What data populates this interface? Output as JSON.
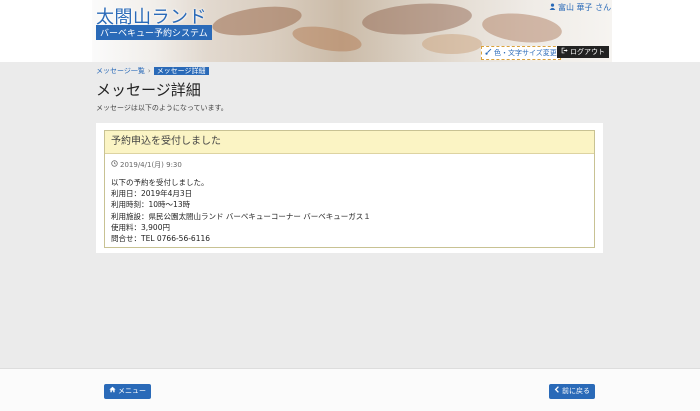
{
  "header": {
    "site_title": "太閤山ランド",
    "site_subtitle": "バーベキュー予約システム",
    "user_name": "富山 華子 さん",
    "color_button": "色・文字サイズ変更",
    "logout_button": "ログアウト"
  },
  "breadcrumb": {
    "list": "メッセージ一覧",
    "current": "メッセージ詳細"
  },
  "page": {
    "title": "メッセージ詳細",
    "description": "メッセージは以下のようになっています。"
  },
  "message": {
    "title": "予約申込を受付しました",
    "date": "2019/4/1(月) 9:30",
    "lines": [
      "以下の予約を受付しました。",
      "利用日：2019年4月3日",
      "利用時刻：10時〜13時",
      "利用施設：県民公園太閤山ランド バーベキューコーナー バーベキューガス１",
      "使用料：3,900円",
      "問合せ：TEL 0766-56-6116"
    ]
  },
  "footer": {
    "menu_button": "メニュー",
    "back_button": "前に戻る"
  },
  "icons": {
    "user": "user-icon",
    "brush": "brush-icon",
    "logout": "logout-icon",
    "clock": "clock-icon",
    "home": "home-icon",
    "back": "chevron-left-icon"
  },
  "colors": {
    "accent": "#2a6ab8",
    "message_header": "#fbf4c4",
    "page_background": "#ebebeb"
  }
}
